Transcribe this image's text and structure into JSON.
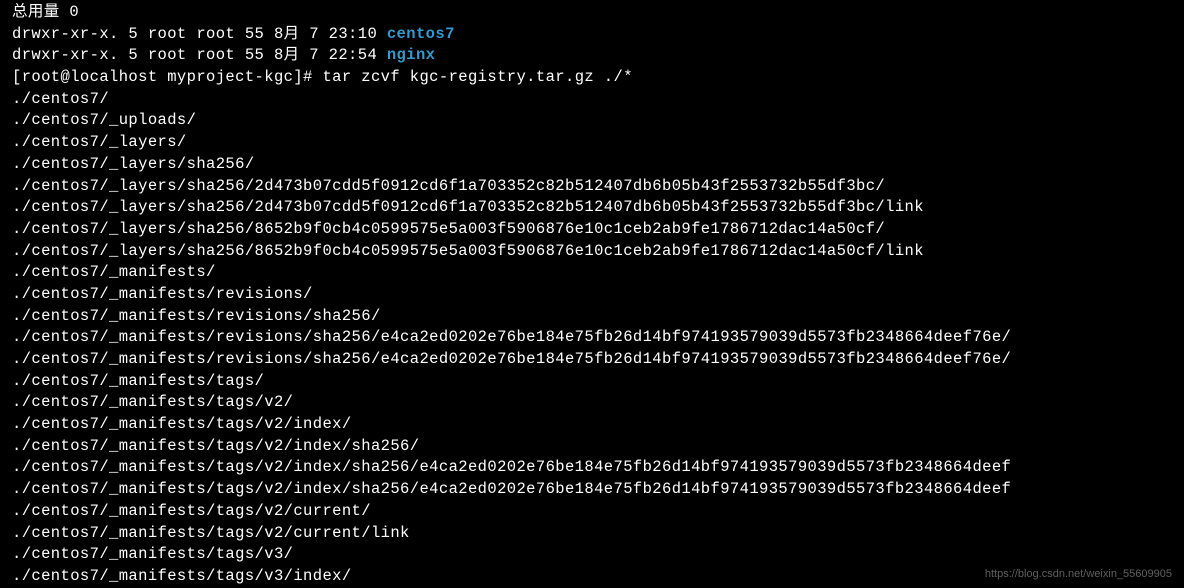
{
  "terminal": {
    "line1_total": "总用量 0",
    "ls_line1_perms": "drwxr-xr-x. 5 root root 55 8月   7 23:10 ",
    "ls_line1_name": "centos7",
    "ls_line2_perms": "drwxr-xr-x. 5 root root 55 8月   7 22:54 ",
    "ls_line2_name": "nginx",
    "prompt": "[root@localhost myproject-kgc]# ",
    "command": "tar zcvf kgc-registry.tar.gz ./*",
    "output": [
      "./centos7/",
      "./centos7/_uploads/",
      "./centos7/_layers/",
      "./centos7/_layers/sha256/",
      "./centos7/_layers/sha256/2d473b07cdd5f0912cd6f1a703352c82b512407db6b05b43f2553732b55df3bc/",
      "./centos7/_layers/sha256/2d473b07cdd5f0912cd6f1a703352c82b512407db6b05b43f2553732b55df3bc/link",
      "./centos7/_layers/sha256/8652b9f0cb4c0599575e5a003f5906876e10c1ceb2ab9fe1786712dac14a50cf/",
      "./centos7/_layers/sha256/8652b9f0cb4c0599575e5a003f5906876e10c1ceb2ab9fe1786712dac14a50cf/link",
      "./centos7/_manifests/",
      "./centos7/_manifests/revisions/",
      "./centos7/_manifests/revisions/sha256/",
      "./centos7/_manifests/revisions/sha256/e4ca2ed0202e76be184e75fb26d14bf974193579039d5573fb2348664deef76e/",
      "./centos7/_manifests/revisions/sha256/e4ca2ed0202e76be184e75fb26d14bf974193579039d5573fb2348664deef76e/",
      "./centos7/_manifests/tags/",
      "./centos7/_manifests/tags/v2/",
      "./centos7/_manifests/tags/v2/index/",
      "./centos7/_manifests/tags/v2/index/sha256/",
      "./centos7/_manifests/tags/v2/index/sha256/e4ca2ed0202e76be184e75fb26d14bf974193579039d5573fb2348664deef",
      "./centos7/_manifests/tags/v2/index/sha256/e4ca2ed0202e76be184e75fb26d14bf974193579039d5573fb2348664deef",
      "./centos7/_manifests/tags/v2/current/",
      "./centos7/_manifests/tags/v2/current/link",
      "./centos7/_manifests/tags/v3/",
      "./centos7/_manifests/tags/v3/index/"
    ]
  },
  "watermark": "https://blog.csdn.net/weixin_55609905"
}
